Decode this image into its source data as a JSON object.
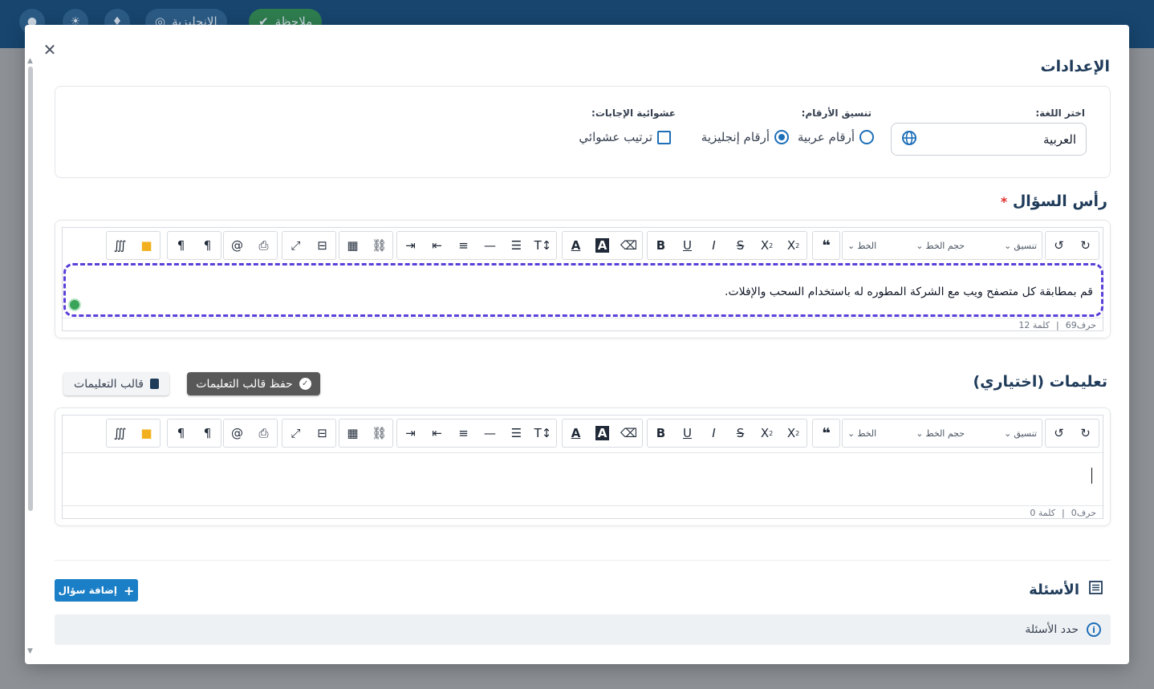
{
  "background": {
    "topbar_items": [
      "الإنجليزية",
      "ملاحظة"
    ]
  },
  "modal": {
    "settings_title": "الإعدادات",
    "language": {
      "label": "اختر اللغة:",
      "value": "العربية"
    },
    "number_format": {
      "label": "تنسيق الأرقام:",
      "options": [
        "أرقام عربية",
        "أرقام إنجليزية"
      ],
      "selected": "أرقام إنجليزية"
    },
    "answer_random": {
      "label": "عشوائية الإجابات:",
      "option": "ترتيب عشوائي",
      "checked": false
    },
    "question_head": {
      "title": "رأس السؤال",
      "required_mark": "*",
      "text": "قم بمطابقة كل متصفح ويب مع الشركة المطوره له باستخدام السحب والإفلات.",
      "char_count": "حرف69",
      "word_count": "كلمة 12"
    },
    "instructions": {
      "title": "تعليمات (اختياري)",
      "save_template_label": "حفظ قالب التعليمات",
      "template_label": "قالب التعليمات",
      "char_count": "حرف0",
      "word_count": "كلمة 0"
    },
    "toolbar": {
      "format_label": "تنسيق",
      "font_size_label": "حجم الخط",
      "font_label": "الخط"
    },
    "questions": {
      "title": "الأسئلة",
      "add_label": "إضافة سؤال",
      "info_text": "حدد الأسئلة"
    }
  },
  "colors": {
    "primary": "#1a7fc6",
    "topbar": "#17456e",
    "dashed_focus": "#5b3fd9",
    "dark_button": "#585858"
  }
}
